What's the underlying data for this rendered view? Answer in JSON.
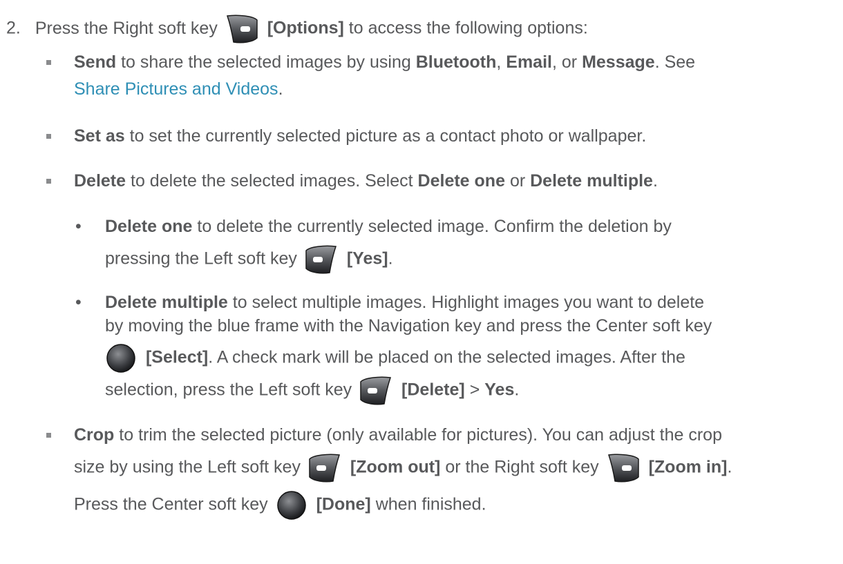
{
  "step": {
    "number": "2.",
    "pre": "Press the Right soft key",
    "key_label": "[Options]",
    "post": "to access the following options:"
  },
  "items": {
    "send": {
      "term": "Send",
      "text1": "to share the selected images by using",
      "opt1": "Bluetooth",
      "sep1": ",",
      "opt2": "Email",
      "sep2": ", or",
      "opt3": "Message",
      "text2": ". See",
      "link": "Share Pictures and Videos",
      "end": "."
    },
    "set_as": {
      "term": "Set as",
      "text": "to set the currently selected picture as a contact photo or wallpaper."
    },
    "delete": {
      "term": "Delete",
      "text1": "to delete the selected images. Select",
      "opt1": "Delete one",
      "text2": "or",
      "opt2": "Delete multiple",
      "end": "."
    },
    "delete_one": {
      "term": "Delete one",
      "text1": "to delete the currently selected image. Confirm the deletion by",
      "text2": "pressing the Left soft key",
      "key_label": "[Yes]",
      "end": "."
    },
    "delete_multiple": {
      "term": "Delete multiple",
      "text1": "to select multiple images. Highlight images you want to delete",
      "text2": "by moving the blue frame with the Navigation key and press the Center soft key",
      "key_label": "[Select]",
      "text3": ". A check mark will be placed on the selected images. After the",
      "text4": "selection, press the Left soft key",
      "key_label2": "[Delete]",
      "gt": ">",
      "yes": "Yes",
      "end": "."
    },
    "crop": {
      "term": "Crop",
      "text1": "to trim the selected picture (only available for pictures). You can adjust the crop",
      "text2": "size by using the Left soft key",
      "key_left_label": "[Zoom out]",
      "text3": "or the Right soft key",
      "key_right_label": "[Zoom in]",
      "end": ".",
      "text4": "Press the Center soft key",
      "key_center_label": "[Done]",
      "text5": "when finished."
    }
  },
  "icons": {
    "right_soft_key": "right-soft-key-icon",
    "left_soft_key": "left-soft-key-icon",
    "center_soft_key": "center-soft-key-icon",
    "square_bullet": "square-bullet-icon",
    "dot_bullet": "dot-bullet-icon"
  },
  "colors": {
    "text": "#58595b",
    "link": "#2f8fb5",
    "bullet": "#8a8b8d"
  }
}
